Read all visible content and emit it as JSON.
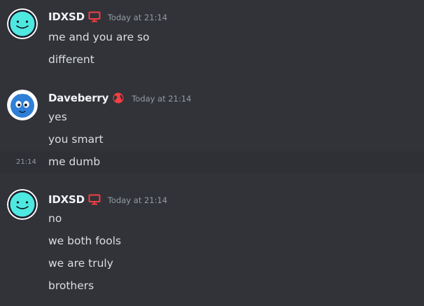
{
  "messages": [
    {
      "author": "IDXSD",
      "author_badge": "monitor-icon",
      "timestamp": "Today at 21:14",
      "avatar": "cyan-smile-avatar",
      "lines": [
        "me and you are so",
        "different"
      ]
    },
    {
      "author": "Daveberry",
      "author_badge": "globe-icon",
      "timestamp": "Today at 21:14",
      "avatar": "blue-creature-avatar",
      "lines": [
        "yes",
        "you smart",
        "me dumb"
      ],
      "hover_time": "21:14"
    },
    {
      "author": "IDXSD",
      "author_badge": "monitor-icon",
      "timestamp": "Today at 21:14",
      "avatar": "cyan-smile-avatar",
      "lines": [
        "no",
        "we both fools",
        "we are truly",
        "brothers"
      ]
    }
  ],
  "colors": {
    "background": "#313338",
    "hover_row": "#2e3035",
    "username": "#f2f3f5",
    "text": "#dbdee1",
    "muted": "#949ba4",
    "badge_red": "#f23f43",
    "avatar_cyan": "#4ee8e0"
  }
}
